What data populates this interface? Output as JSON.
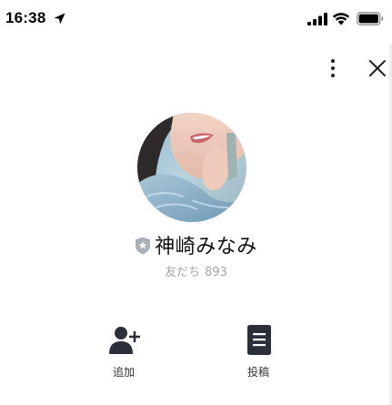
{
  "status_bar": {
    "time": "16:38",
    "location_icon": "location-arrow-icon",
    "signal_icon": "cellular-signal-icon",
    "wifi_icon": "wifi-icon",
    "battery_icon": "battery-icon"
  },
  "header": {
    "more_icon": "vertical-ellipsis-icon",
    "close_icon": "close-icon"
  },
  "profile": {
    "avatar": "profile-photo",
    "badge_icon": "shield-star-icon",
    "badge_color": "#a9b0ba",
    "name": "神崎みなみ",
    "friends_label": "友だち",
    "friends_count": "893"
  },
  "actions": [
    {
      "icon": "add-friend-icon",
      "label": "追加"
    },
    {
      "icon": "post-document-icon",
      "label": "投稿"
    }
  ],
  "colors": {
    "background": "#ffffff",
    "text_primary": "#111111",
    "text_secondary": "#a3a7ad",
    "icon_dark": "#2a2f3a"
  }
}
